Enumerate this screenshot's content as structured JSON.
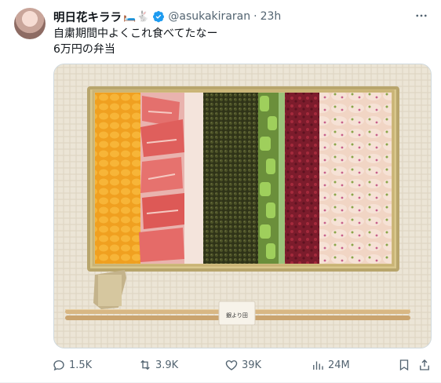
{
  "author": {
    "display_name": "明日花キララ",
    "emoji": "🛏️🐇",
    "handle": "@asukakiraran",
    "separator": "·",
    "time": "23h",
    "verified_color": "#1d9bf0"
  },
  "tweet": {
    "line1": "自粛期間中よくこれ食べてたなー",
    "line2": "6万円の弁当"
  },
  "media": {
    "chopstick_wrapper_text": "銀より田"
  },
  "actions": {
    "replies": "1.5K",
    "retweets": "3.9K",
    "likes": "39K",
    "views": "24M"
  },
  "colors": {
    "text": "#0f1419",
    "muted": "#536471",
    "accent": "#1d9bf0"
  },
  "icons": [
    "reply-icon",
    "retweet-icon",
    "like-icon",
    "views-icon",
    "bookmark-icon",
    "share-icon",
    "more-icon",
    "verified-icon"
  ]
}
